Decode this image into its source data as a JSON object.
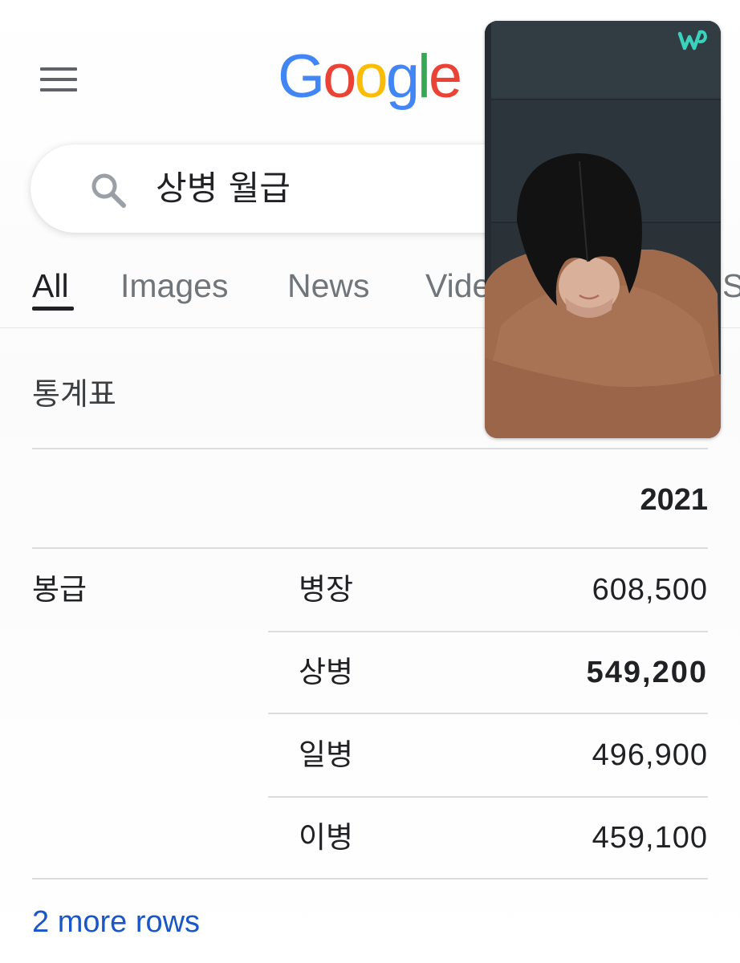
{
  "header": {
    "menu_icon": "hamburger-menu-icon",
    "logo_letters": [
      {
        "char": "G",
        "color": "#4285F4"
      },
      {
        "char": "o",
        "color": "#EA4335"
      },
      {
        "char": "o",
        "color": "#FBBC05"
      },
      {
        "char": "g",
        "color": "#4285F4"
      },
      {
        "char": "l",
        "color": "#34A853"
      },
      {
        "char": "e",
        "color": "#EA4335"
      }
    ]
  },
  "search": {
    "icon": "search-icon",
    "query": "상병 월급"
  },
  "tabs": [
    {
      "label": "All",
      "active": true
    },
    {
      "label": "Images",
      "active": false
    },
    {
      "label": "News",
      "active": false
    },
    {
      "label": "Vide",
      "active": false
    },
    {
      "label": "S",
      "active": false
    }
  ],
  "stats": {
    "title": "통계표",
    "year_header": "2021",
    "group_label": "봉급",
    "rows": [
      {
        "rank": "병장",
        "amount": "608,500",
        "highlighted": false
      },
      {
        "rank": "상병",
        "amount": "549,200",
        "highlighted": true
      },
      {
        "rank": "일병",
        "amount": "496,900",
        "highlighted": false
      },
      {
        "rank": "이병",
        "amount": "459,100",
        "highlighted": false
      }
    ],
    "more_rows_link": "2 more rows"
  },
  "video_overlay": {
    "app_icon": "weverse-logo-icon",
    "accent_color": "#3ad1bd"
  }
}
